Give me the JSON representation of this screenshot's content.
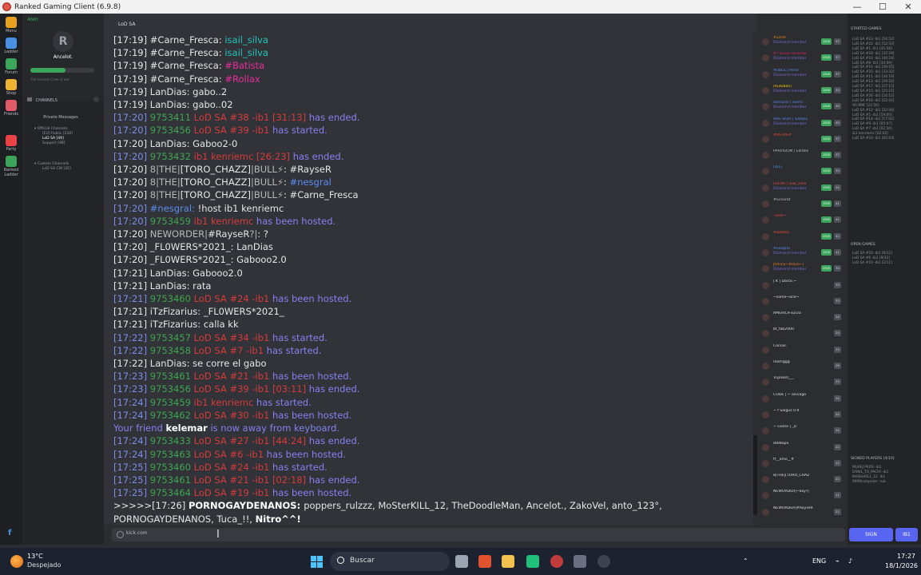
{
  "window": {
    "title": "Ranked Gaming Client (6.9.8)",
    "min": "—",
    "max": "☐",
    "close": "✕"
  },
  "rail": [
    {
      "label": "Menu",
      "color": "#e8a020"
    },
    {
      "label": "Ladder",
      "color": "#4a90e2"
    },
    {
      "label": "Forum",
      "color": "#3ba55c"
    },
    {
      "label": "Shop",
      "color": "#f0b232"
    },
    {
      "label": "Friends",
      "color": "#e05a6a"
    },
    {
      "label": "Party",
      "color": "#ed4245"
    },
    {
      "label": "Ranked Ladder",
      "color": "#3ba55c"
    }
  ],
  "profile": {
    "status": "AWAY",
    "avatar_text": "R",
    "name": "Ancelot.",
    "xp": 0.55,
    "sub": "The Ancient Crew of war",
    "channels_label": "CHANNELS",
    "private_messages": "Private Messages",
    "official": "Official Channels",
    "official_items": [
      "[EU] Public [228]",
      "LoD SA [49]",
      "Support [98]"
    ],
    "custom": "Custom Channels",
    "custom_items": [
      "LoD SA CW [45]"
    ]
  },
  "chat": {
    "tab": "LoD SA",
    "input_placeholder": "kick.com"
  },
  "messages": [
    {
      "ts": "[17:19]",
      "parts": [
        [
          "plain",
          "#Carne_Fresca: "
        ],
        [
          "cyan",
          "isail_silva"
        ]
      ]
    },
    {
      "ts": "[17:19]",
      "parts": [
        [
          "plain",
          "#Carne_Fresca: "
        ],
        [
          "cyan",
          "isail_silva"
        ]
      ]
    },
    {
      "ts": "[17:19]",
      "parts": [
        [
          "plain",
          "#Carne_Fresca: "
        ],
        [
          "pink",
          "#Batista"
        ]
      ]
    },
    {
      "ts": "[17:19]",
      "parts": [
        [
          "plain",
          "#Carne_Fresca: "
        ],
        [
          "pink",
          "#Rollax"
        ]
      ]
    },
    {
      "ts": "[17:19]",
      "parts": [
        [
          "plain",
          "LanDias: gabo..2"
        ]
      ]
    },
    {
      "ts": "[17:19]",
      "parts": [
        [
          "plain",
          "LanDias: gabo..02"
        ]
      ]
    },
    {
      "ts": "[17:20]",
      "blue": true,
      "parts": [
        [
          "gid",
          "9753411"
        ],
        [
          "gname",
          "LoD SA #38 -ib1 [31:13]"
        ],
        [
          "ev",
          "has ended."
        ]
      ]
    },
    {
      "ts": "[17:20]",
      "blue": true,
      "parts": [
        [
          "gid",
          "9753456"
        ],
        [
          "gname",
          "LoD SA #39 -ib1"
        ],
        [
          "ev",
          "has started."
        ]
      ]
    },
    {
      "ts": "[17:20]",
      "parts": [
        [
          "plain",
          "LanDias: Gaboo2-0"
        ]
      ]
    },
    {
      "ts": "[17:20]",
      "blue": true,
      "parts": [
        [
          "gid",
          "9753432"
        ],
        [
          "gname",
          "ib1 kenriemc [26:23]"
        ],
        [
          "ev",
          "has ended."
        ]
      ]
    },
    {
      "ts": "[17:20]",
      "parts": [
        [
          "clan",
          "8|THE|"
        ],
        [
          "plain",
          "[TORO_CHAZZ]"
        ],
        [
          "clan",
          "|BULL⚡"
        ],
        [
          "plain",
          ": #RayseR"
        ]
      ]
    },
    {
      "ts": "[17:20]",
      "parts": [
        [
          "clan",
          "8|THE|"
        ],
        [
          "plain",
          "[TORO_CHAZZ]"
        ],
        [
          "clan",
          "|BULL⚡"
        ],
        [
          "plain",
          ": "
        ],
        [
          "blue",
          "#nesgral"
        ]
      ]
    },
    {
      "ts": "[17:20]",
      "parts": [
        [
          "clan",
          "8|THE|"
        ],
        [
          "plain",
          "[TORO_CHAZZ]"
        ],
        [
          "clan",
          "|BULL⚡"
        ],
        [
          "plain",
          ": #Carne_Fresca"
        ]
      ]
    },
    {
      "ts": "[17:20]",
      "blue": true,
      "parts": [
        [
          "blue",
          "#nesgral: "
        ],
        [
          "plain",
          "!host ib1 kenriemc"
        ]
      ]
    },
    {
      "ts": "[17:20]",
      "blue": true,
      "parts": [
        [
          "gid",
          "9753459"
        ],
        [
          "gname",
          "ib1 kenriemc"
        ],
        [
          "ev",
          "has been hosted."
        ]
      ]
    },
    {
      "ts": "[17:20]",
      "parts": [
        [
          "clan",
          "NEWORDER|"
        ],
        [
          "plain",
          "#RayseR"
        ],
        [
          "clan",
          "?|"
        ],
        [
          "plain",
          ": ?"
        ]
      ]
    },
    {
      "ts": "[17:20]",
      "parts": [
        [
          "plain",
          "_FL0WERS*2021_: LanDias"
        ]
      ]
    },
    {
      "ts": "[17:20]",
      "parts": [
        [
          "plain",
          "_FL0WERS*2021_: Gabooo2.0"
        ]
      ]
    },
    {
      "ts": "[17:21]",
      "parts": [
        [
          "plain",
          "LanDias: Gabooo2.0"
        ]
      ]
    },
    {
      "ts": "[17:21]",
      "parts": [
        [
          "plain",
          "LanDias: rata"
        ]
      ]
    },
    {
      "ts": "[17:21]",
      "blue": true,
      "parts": [
        [
          "gid",
          "9753460"
        ],
        [
          "gname",
          "LoD SA #24 -ib1"
        ],
        [
          "ev",
          "has been hosted."
        ]
      ]
    },
    {
      "ts": "[17:21]",
      "parts": [
        [
          "plain",
          "iTzFizarius: _FL0WERS*2021_"
        ]
      ]
    },
    {
      "ts": "[17:21]",
      "parts": [
        [
          "plain",
          "iTzFizarius: calla kk"
        ]
      ]
    },
    {
      "ts": "[17:22]",
      "blue": true,
      "parts": [
        [
          "gid",
          "9753457"
        ],
        [
          "gname",
          "LoD SA #34 -ib1"
        ],
        [
          "ev",
          "has started."
        ]
      ]
    },
    {
      "ts": "[17:22]",
      "blue": true,
      "parts": [
        [
          "gid",
          "9753458"
        ],
        [
          "gname",
          "LoD SA #7 -ib1"
        ],
        [
          "ev",
          "has started."
        ]
      ]
    },
    {
      "ts": "[17:22]",
      "parts": [
        [
          "plain",
          "LanDias: se corre el gabo"
        ]
      ]
    },
    {
      "ts": "[17:23]",
      "blue": true,
      "parts": [
        [
          "gid",
          "9753461"
        ],
        [
          "gname",
          "LoD SA #21 -ib1"
        ],
        [
          "ev",
          "has been hosted."
        ]
      ]
    },
    {
      "ts": "[17:23]",
      "blue": true,
      "parts": [
        [
          "gid",
          "9753456"
        ],
        [
          "gname",
          "LoD SA #39 -ib1 [03:11]"
        ],
        [
          "ev",
          "has ended."
        ]
      ]
    },
    {
      "ts": "[17:24]",
      "blue": true,
      "parts": [
        [
          "gid",
          "9753459"
        ],
        [
          "gname",
          "ib1 kenriemc"
        ],
        [
          "ev",
          "has started."
        ]
      ]
    },
    {
      "ts": "[17:24]",
      "blue": true,
      "parts": [
        [
          "gid",
          "9753462"
        ],
        [
          "gname",
          "LoD SA #30 -ib1"
        ],
        [
          "ev",
          "has been hosted."
        ]
      ]
    },
    {
      "ts": "",
      "friend": true,
      "parts": [
        [
          "friend",
          "Your friend "
        ],
        [
          "bold",
          "kelemar"
        ],
        [
          "friend",
          " is now away from keyboard."
        ]
      ]
    },
    {
      "ts": "[17:24]",
      "blue": true,
      "parts": [
        [
          "gid",
          "9753433"
        ],
        [
          "gname",
          "LoD SA #27 -ib1 [44:24]"
        ],
        [
          "ev",
          "has ended."
        ]
      ]
    },
    {
      "ts": "[17:24]",
      "blue": true,
      "parts": [
        [
          "gid",
          "9753463"
        ],
        [
          "gname",
          "LoD SA #6 -ib1"
        ],
        [
          "ev",
          "has been hosted."
        ]
      ]
    },
    {
      "ts": "[17:25]",
      "blue": true,
      "parts": [
        [
          "gid",
          "9753460"
        ],
        [
          "gname",
          "LoD SA #24 -ib1"
        ],
        [
          "ev",
          "has started."
        ]
      ]
    },
    {
      "ts": "[17:25]",
      "blue": true,
      "parts": [
        [
          "gid",
          "9753461"
        ],
        [
          "gname",
          "LoD SA #21 -ib1 [02:18]"
        ],
        [
          "ev",
          "has ended."
        ]
      ]
    },
    {
      "ts": "[17:25]",
      "blue": true,
      "parts": [
        [
          "gid",
          "9753464"
        ],
        [
          "gname",
          "LoD SA #19 -ib1"
        ],
        [
          "ev",
          "has been hosted."
        ]
      ]
    }
  ],
  "last_message": {
    "prefix": ">>>>>[17:26] ",
    "name": "PORNOGAYDENANOS: ",
    "text": "poppers_rulzzz, MoSterKILL_12, TheDoodleMan, Ancelot., ZakoVel, anto_123°, PORNOGAYDENANOS, Tuca_!!, ",
    "tail": "Nitro^^!"
  },
  "users": [
    {
      "name": "#Zedd",
      "sub": "Diamond member",
      "color": "#e67e22",
      "box": "1500",
      "n": "57"
    },
    {
      "name": "#^Lorey~Aracely",
      "sub": "Diamond member",
      "color": "#e91e63",
      "box": "1500",
      "n": "57"
    },
    {
      "name": "#[IBGC] PerSI",
      "sub": "Diamond member",
      "color": "#5b8cf0",
      "box": "1500",
      "n": "57"
    },
    {
      "name": "(AutoBan)",
      "sub": "Diamond member",
      "color": "#f1c40f",
      "box": "1500",
      "n": "44"
    },
    {
      "name": "Samurai | rSemi",
      "sub": "Diamond member",
      "color": "#5b8cf0",
      "box": "1500",
      "n": "40"
    },
    {
      "name": "ARG Start | Sampa",
      "sub": "Diamond member",
      "color": "#5b8cf0",
      "box": "1500",
      "n": "40"
    },
    {
      "name": "#BSTAR#",
      "sub": "",
      "color": "#e74c3c",
      "box": "1500",
      "n": "37"
    },
    {
      "name": "PARVISION | Ellitalo",
      "sub": "",
      "color": "#b5bac1",
      "box": "1500",
      "n": "37"
    },
    {
      "name": "[ib1]",
      "sub": "",
      "color": "#5b8cf0",
      "box": "1500",
      "n": "33"
    },
    {
      "name": "LUCRA | isail_silva",
      "sub": "Diamond member",
      "color": "#e74c3c",
      "box": "1500",
      "n": "24"
    },
    {
      "name": "#Scoorat",
      "sub": "",
      "color": "#b5bac1",
      "box": "1500",
      "n": "41"
    },
    {
      "name": "~Jedi~",
      "sub": "",
      "color": "#e74c3c",
      "box": "1500",
      "n": "41"
    },
    {
      "name": "#Batista",
      "sub": "",
      "color": "#e74c3c",
      "box": "1500",
      "n": "41"
    },
    {
      "name": "#nesgral",
      "sub": "Diamond member",
      "color": "#5b8cf0",
      "box": "1500",
      "n": "41"
    },
    {
      "name": "Jhonny~Bravo~|",
      "sub": "Diamond member",
      "color": "#e67e22",
      "box": "1500",
      "n": "34"
    },
    {
      "name": "| K | Darco.~",
      "sub": "",
      "color": "#ddd",
      "box": "",
      "n": "33"
    },
    {
      "name": "~some~one~",
      "sub": "",
      "color": "#ddd",
      "box": "",
      "n": "33"
    },
    {
      "name": "AMERICA-EEUU",
      "sub": "",
      "color": "#ddd",
      "box": "",
      "n": "24"
    },
    {
      "name": "bf_fab2000",
      "sub": "",
      "color": "#ddd",
      "box": "",
      "n": "24"
    },
    {
      "name": "Corsair.",
      "sub": "",
      "color": "#ddd",
      "box": "",
      "n": "25"
    },
    {
      "name": "roomggg",
      "sub": "",
      "color": "#ddd",
      "box": "",
      "n": "26"
    },
    {
      "name": "TriplekilI___",
      "sub": "",
      "color": "#ddd",
      "box": "",
      "n": "25"
    },
    {
      "name": "CODE | ~ alvvago",
      "sub": "",
      "color": "#ddd",
      "box": "",
      "n": "24"
    },
    {
      "name": "~ f Salgus 0.9",
      "sub": "",
      "color": "#ddd",
      "box": "",
      "n": "24"
    },
    {
      "name": "~ Game | _D",
      "sub": "",
      "color": "#ddd",
      "box": "",
      "n": "24"
    },
    {
      "name": "iKKNope",
      "sub": "",
      "color": "#ddd",
      "box": "",
      "n": "22"
    },
    {
      "name": "ff__amo__ff",
      "sub": "",
      "color": "#ddd",
      "box": "",
      "n": "22"
    },
    {
      "name": "8|THE|[TORO_CHAZ",
      "sub": "",
      "color": "#ddd",
      "box": "",
      "n": "21"
    },
    {
      "name": "NEWORDER|~kay?|",
      "sub": "",
      "color": "#ddd",
      "box": "",
      "n": "21"
    },
    {
      "name": "NEWORDER|#RayseR",
      "sub": "",
      "color": "#ddd",
      "box": "",
      "n": "21"
    }
  ],
  "right": {
    "started_label": "STARTED GAMES",
    "started": [
      "LoD SA #23 -ib1 [54:52]",
      "LoD SA #22 -ib1 [52:33]",
      "LoD SA #1 -ib1 [45:58]",
      "LoD SA #29 -ib1 [37:29]",
      "LoD SA #16 -ib1 [40:24]",
      "LoD SA #8 -ib1 [34:09]",
      "LoD SA #10 -ib1 [39:55]",
      "LoD SA #25 -ib1 [33:32]",
      "LoD SA #11 -ib1 [34:19]",
      "LoD SA #13 -ib1 [29:50]",
      "LoD SA #17 -ib1 [27:15]",
      "LoD SA #15 -ib1 [25:21]",
      "LoD SA #26 -ib1 [24:15]",
      "LoD SA #18 -ib1 [22:41]",
      "AR RMF [22:56]",
      "LoD SA #12 -ib1 [22:44]",
      "LoD SA #5 -ib1 [19:00]",
      "LoD SA #14 -ib1 [17:02]",
      "LoD SA #9 -ib1 [05:07]",
      "LoD SA #7 -ib1 [02:50]",
      "ib1 kenriemc [02:02]",
      "LoD SA #24 -ib1 [02:03]"
    ],
    "open_label": "OPEN GAMES",
    "open": [
      "LoD SA #20 -ib1 [9/12]",
      "LoD SA #6 -ib1 [9/12]",
      "LoD SA #19 -ib1 [2/12]"
    ],
    "signed_label": "SIGNED PLAYERS [4/10]",
    "signed": [
      "MUAEJ PROS -ib1",
      "DANIL_TU_PACHI -ib1",
      "MoSterKILL_12 -ib1",
      "9999computer -rub"
    ],
    "sign_btn": "SIGN",
    "server_btn": "IB1"
  },
  "taskbar": {
    "temp": "13°C",
    "weather": "Despejado",
    "search": "Buscar",
    "lang": "ENG",
    "time": "17:27",
    "date": "18/1/2026"
  }
}
